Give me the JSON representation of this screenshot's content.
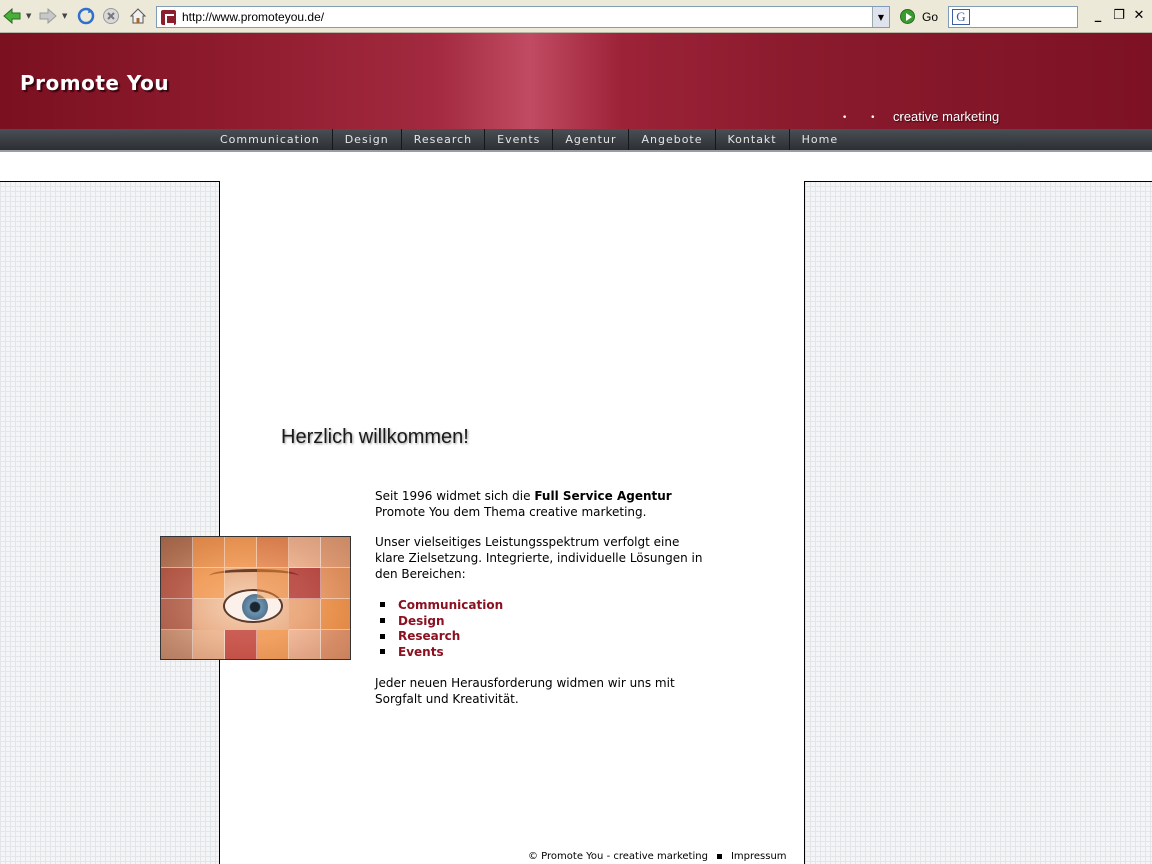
{
  "browser": {
    "url": "http://www.promoteyou.de/",
    "go_label": "Go"
  },
  "header": {
    "logo": "Promote You",
    "tagline_dots": "• • •",
    "tagline": "creative marketing"
  },
  "nav": {
    "items": [
      "Communication",
      "Design",
      "Research",
      "Events",
      "Agentur",
      "Angebote",
      "Kontakt",
      "Home"
    ]
  },
  "main": {
    "welcome": "Herzlich willkommen!",
    "intro_prefix": "Seit 1996 widmet sich die ",
    "intro_bold": "Full Service Agentur",
    "intro_suffix": "Promote You dem Thema creative marketing.",
    "para2": "Unser vielseitiges Leistungsspektrum verfolgt eine klare Zielsetzung. Integrierte, individuelle Lösungen in den Bereichen:",
    "services": [
      "Communication",
      "Design",
      "Research",
      "Events"
    ],
    "closing": "Jeder neuen Herausforderung widmen wir uns mit Sorgfalt und Kreativität."
  },
  "footer": {
    "copyright": "© Promote You - creative marketing",
    "impressum": "Impressum"
  },
  "colors": {
    "brand": "#8b1d2c",
    "link": "#8b1020",
    "nav_bg": "#2c3035"
  }
}
